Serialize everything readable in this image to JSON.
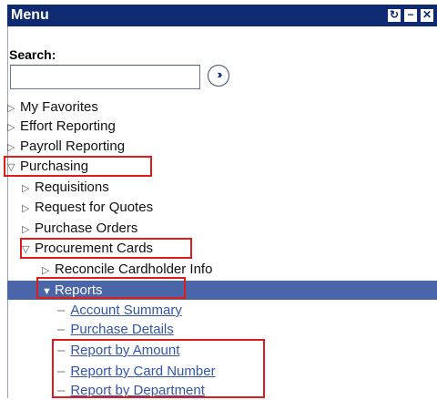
{
  "header": {
    "title": "Menu",
    "refresh_icon": "refresh-icon",
    "minimize_icon": "minimize-icon",
    "close_icon": "close-icon"
  },
  "search": {
    "label": "Search:",
    "value": "",
    "placeholder": "",
    "go_icon": "double-chevron-right-icon"
  },
  "menu": {
    "items": [
      {
        "label": "My Favorites",
        "state": "collapsed"
      },
      {
        "label": "Effort Reporting",
        "state": "collapsed"
      },
      {
        "label": "Payroll Reporting",
        "state": "collapsed"
      },
      {
        "label": "Purchasing",
        "state": "expanded"
      },
      {
        "label": "Requisitions",
        "state": "collapsed"
      },
      {
        "label": "Request for Quotes",
        "state": "collapsed"
      },
      {
        "label": "Purchase Orders",
        "state": "collapsed"
      },
      {
        "label": "Procurement Cards",
        "state": "expanded"
      },
      {
        "label": "Reconcile Cardholder Info",
        "state": "collapsed"
      },
      {
        "label": "Reports",
        "state": "expanded-selected"
      }
    ],
    "reports": [
      {
        "label": "Account Summary"
      },
      {
        "label": "Purchase Details"
      },
      {
        "label": "Report by Amount"
      },
      {
        "label": "Report by Card Number"
      },
      {
        "label": "Report by Department"
      }
    ]
  },
  "colors": {
    "header_bg": "#0e2a72",
    "selected_bg": "#4a66a8",
    "link": "#3355aa",
    "highlight": "#e01b1b"
  }
}
